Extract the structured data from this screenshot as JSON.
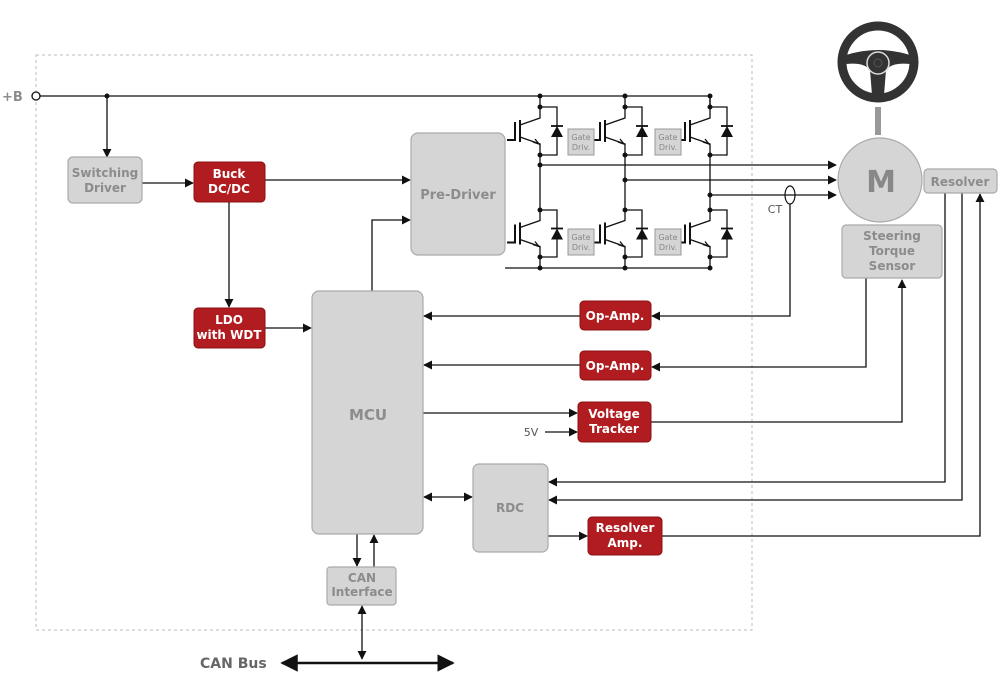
{
  "colors": {
    "accent_red": "#b01c1f",
    "block_gray": "#d5d5d5",
    "label_gray": "#8c8c8c"
  },
  "labels": {
    "plus_b": "+B",
    "ct": "CT",
    "five_v": "5V",
    "can_bus": "CAN Bus",
    "motor": "M"
  },
  "blocks": {
    "switching_driver": [
      "Switching",
      "Driver"
    ],
    "buck": [
      "Buck",
      "DC/DC"
    ],
    "ldo": [
      "LDO",
      "with WDT"
    ],
    "pre_driver": "Pre-Driver",
    "mcu": "MCU",
    "op_amp_1": "Op-Amp.",
    "op_amp_2": "Op-Amp.",
    "voltage_tracker": [
      "Voltage",
      "Tracker"
    ],
    "rdc": "RDC",
    "resolver_amp": [
      "Resolver",
      "Amp."
    ],
    "can_interface": [
      "CAN",
      "Interface"
    ],
    "resolver": "Resolver",
    "torque_sensor": [
      "Steering",
      "Torque",
      "Sensor"
    ],
    "gate_driv": [
      "Gate",
      "Driv."
    ]
  },
  "icons": {
    "steering_wheel": "steering-wheel-icon",
    "motor": "motor-circle"
  }
}
